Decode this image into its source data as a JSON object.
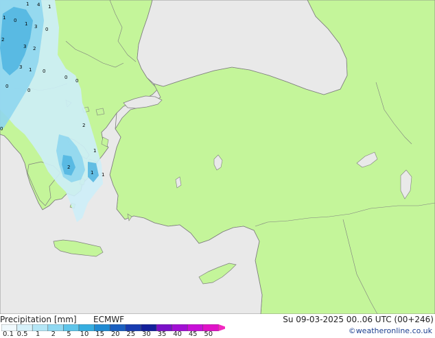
{
  "colors": {
    "sea": "#e9e9e9",
    "land": "#c4f59a",
    "coast": "#7d7d7d",
    "precip_light": "#cdeef8",
    "precip_mid": "#8fd6ee",
    "precip_strong": "#4fb4e0"
  },
  "map": {
    "precip_labels": [
      "1",
      "4",
      "1",
      "1",
      "0",
      "1",
      "3",
      "0",
      "2",
      "3",
      "2",
      "3",
      "1",
      "0",
      "0",
      "0",
      "0",
      "2",
      "1",
      "2",
      "1",
      "1",
      "0",
      "0"
    ]
  },
  "footer": {
    "product": "Precipitation [mm]",
    "model": "ECMWF",
    "valid_time": "Su 09-03-2025 00..06 UTC (00+246)",
    "credit": "©weatheronline.co.uk"
  },
  "legend": {
    "ticks": [
      "0.1",
      "0.5",
      "1",
      "2",
      "5",
      "10",
      "15",
      "20",
      "25",
      "30",
      "35",
      "40",
      "45",
      "50"
    ],
    "colors": [
      "#f0f9fd",
      "#d6f1fa",
      "#b4e6f6",
      "#8fd8f1",
      "#5fc5ea",
      "#36aee0",
      "#1f8ad2",
      "#1a5fc0",
      "#173bb0",
      "#13209b",
      "#7a10c8",
      "#a20fd4",
      "#c80fd8",
      "#e012c8",
      "#f229c0"
    ]
  }
}
